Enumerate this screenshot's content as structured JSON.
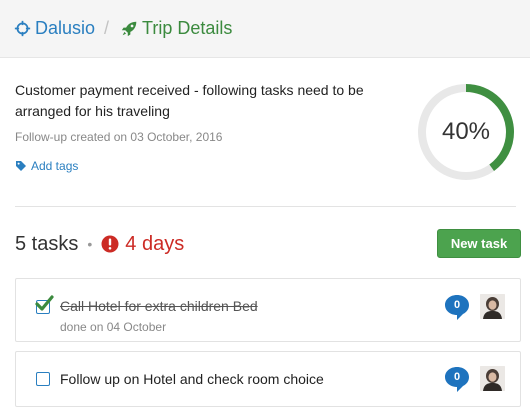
{
  "breadcrumb": {
    "home_label": "Dalusio",
    "home_icon": "crosshair-icon",
    "separator": "/",
    "current_label": "Trip Details",
    "current_icon": "rocket-icon"
  },
  "summary": {
    "description": "Customer payment received - following tasks need to be arranged for his traveling",
    "followup": "Follow-up created on 03 October, 2016",
    "add_tags_label": "Add tags",
    "progress_percent": 40,
    "progress_label": "40%"
  },
  "tasks_header": {
    "count_label": "5 tasks",
    "bullet": "•",
    "days_label": "4 days",
    "new_task_label": "New task"
  },
  "tasks": [
    {
      "title": "Call Hotel for extra children Bed",
      "status": "done on 04 October",
      "done": true,
      "comments": "0"
    },
    {
      "title": "Follow up on Hotel and check room choice",
      "status": "",
      "done": false,
      "comments": "0"
    }
  ],
  "colors": {
    "link_blue": "#2a7fc0",
    "green": "#3b8a3e",
    "progress_green": "#3f8f41",
    "progress_track": "#e8e8e8",
    "alert_red": "#cc2b25",
    "comment_blue": "#1e73be"
  }
}
